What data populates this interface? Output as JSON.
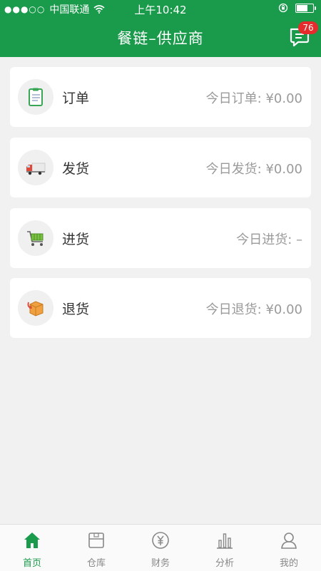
{
  "status_bar": {
    "signal": "●●●○○",
    "carrier": "中国联通",
    "time": "上午10:42"
  },
  "header": {
    "title": "餐链–供应商",
    "message_badge": "76"
  },
  "cards": [
    {
      "label": "订单",
      "value": "今日订单: ¥0.00",
      "icon": "clipboard-icon"
    },
    {
      "label": "发货",
      "value": "今日发货: ¥0.00",
      "icon": "truck-icon"
    },
    {
      "label": "进货",
      "value": "今日进货: –",
      "icon": "cart-icon"
    },
    {
      "label": "退货",
      "value": "今日退货: ¥0.00",
      "icon": "return-box-icon"
    }
  ],
  "tabs": [
    {
      "label": "首页",
      "icon": "home-icon",
      "active": true
    },
    {
      "label": "仓库",
      "icon": "warehouse-icon",
      "active": false
    },
    {
      "label": "财务",
      "icon": "yuan-icon",
      "active": false
    },
    {
      "label": "分析",
      "icon": "bar-chart-icon",
      "active": false
    },
    {
      "label": "我的",
      "icon": "user-icon",
      "active": false
    }
  ],
  "colors": {
    "brand_green": "#1a9a4b",
    "badge_red": "#e52b2b"
  }
}
